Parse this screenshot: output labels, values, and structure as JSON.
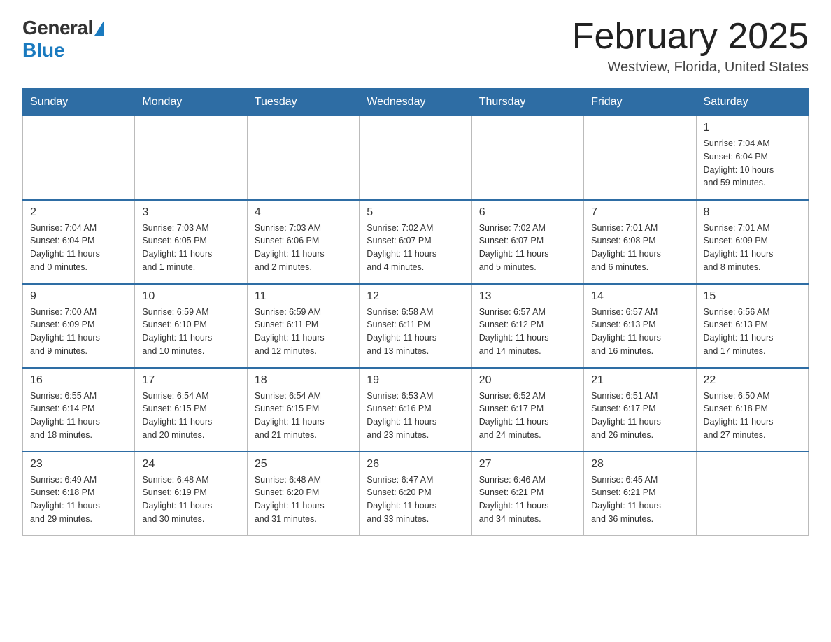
{
  "header": {
    "logo_general": "General",
    "logo_blue": "Blue",
    "title": "February 2025",
    "location": "Westview, Florida, United States"
  },
  "days_of_week": [
    "Sunday",
    "Monday",
    "Tuesday",
    "Wednesday",
    "Thursday",
    "Friday",
    "Saturday"
  ],
  "weeks": [
    [
      {
        "day": "",
        "info": ""
      },
      {
        "day": "",
        "info": ""
      },
      {
        "day": "",
        "info": ""
      },
      {
        "day": "",
        "info": ""
      },
      {
        "day": "",
        "info": ""
      },
      {
        "day": "",
        "info": ""
      },
      {
        "day": "1",
        "info": "Sunrise: 7:04 AM\nSunset: 6:04 PM\nDaylight: 10 hours\nand 59 minutes."
      }
    ],
    [
      {
        "day": "2",
        "info": "Sunrise: 7:04 AM\nSunset: 6:04 PM\nDaylight: 11 hours\nand 0 minutes."
      },
      {
        "day": "3",
        "info": "Sunrise: 7:03 AM\nSunset: 6:05 PM\nDaylight: 11 hours\nand 1 minute."
      },
      {
        "day": "4",
        "info": "Sunrise: 7:03 AM\nSunset: 6:06 PM\nDaylight: 11 hours\nand 2 minutes."
      },
      {
        "day": "5",
        "info": "Sunrise: 7:02 AM\nSunset: 6:07 PM\nDaylight: 11 hours\nand 4 minutes."
      },
      {
        "day": "6",
        "info": "Sunrise: 7:02 AM\nSunset: 6:07 PM\nDaylight: 11 hours\nand 5 minutes."
      },
      {
        "day": "7",
        "info": "Sunrise: 7:01 AM\nSunset: 6:08 PM\nDaylight: 11 hours\nand 6 minutes."
      },
      {
        "day": "8",
        "info": "Sunrise: 7:01 AM\nSunset: 6:09 PM\nDaylight: 11 hours\nand 8 minutes."
      }
    ],
    [
      {
        "day": "9",
        "info": "Sunrise: 7:00 AM\nSunset: 6:09 PM\nDaylight: 11 hours\nand 9 minutes."
      },
      {
        "day": "10",
        "info": "Sunrise: 6:59 AM\nSunset: 6:10 PM\nDaylight: 11 hours\nand 10 minutes."
      },
      {
        "day": "11",
        "info": "Sunrise: 6:59 AM\nSunset: 6:11 PM\nDaylight: 11 hours\nand 12 minutes."
      },
      {
        "day": "12",
        "info": "Sunrise: 6:58 AM\nSunset: 6:11 PM\nDaylight: 11 hours\nand 13 minutes."
      },
      {
        "day": "13",
        "info": "Sunrise: 6:57 AM\nSunset: 6:12 PM\nDaylight: 11 hours\nand 14 minutes."
      },
      {
        "day": "14",
        "info": "Sunrise: 6:57 AM\nSunset: 6:13 PM\nDaylight: 11 hours\nand 16 minutes."
      },
      {
        "day": "15",
        "info": "Sunrise: 6:56 AM\nSunset: 6:13 PM\nDaylight: 11 hours\nand 17 minutes."
      }
    ],
    [
      {
        "day": "16",
        "info": "Sunrise: 6:55 AM\nSunset: 6:14 PM\nDaylight: 11 hours\nand 18 minutes."
      },
      {
        "day": "17",
        "info": "Sunrise: 6:54 AM\nSunset: 6:15 PM\nDaylight: 11 hours\nand 20 minutes."
      },
      {
        "day": "18",
        "info": "Sunrise: 6:54 AM\nSunset: 6:15 PM\nDaylight: 11 hours\nand 21 minutes."
      },
      {
        "day": "19",
        "info": "Sunrise: 6:53 AM\nSunset: 6:16 PM\nDaylight: 11 hours\nand 23 minutes."
      },
      {
        "day": "20",
        "info": "Sunrise: 6:52 AM\nSunset: 6:17 PM\nDaylight: 11 hours\nand 24 minutes."
      },
      {
        "day": "21",
        "info": "Sunrise: 6:51 AM\nSunset: 6:17 PM\nDaylight: 11 hours\nand 26 minutes."
      },
      {
        "day": "22",
        "info": "Sunrise: 6:50 AM\nSunset: 6:18 PM\nDaylight: 11 hours\nand 27 minutes."
      }
    ],
    [
      {
        "day": "23",
        "info": "Sunrise: 6:49 AM\nSunset: 6:18 PM\nDaylight: 11 hours\nand 29 minutes."
      },
      {
        "day": "24",
        "info": "Sunrise: 6:48 AM\nSunset: 6:19 PM\nDaylight: 11 hours\nand 30 minutes."
      },
      {
        "day": "25",
        "info": "Sunrise: 6:48 AM\nSunset: 6:20 PM\nDaylight: 11 hours\nand 31 minutes."
      },
      {
        "day": "26",
        "info": "Sunrise: 6:47 AM\nSunset: 6:20 PM\nDaylight: 11 hours\nand 33 minutes."
      },
      {
        "day": "27",
        "info": "Sunrise: 6:46 AM\nSunset: 6:21 PM\nDaylight: 11 hours\nand 34 minutes."
      },
      {
        "day": "28",
        "info": "Sunrise: 6:45 AM\nSunset: 6:21 PM\nDaylight: 11 hours\nand 36 minutes."
      },
      {
        "day": "",
        "info": ""
      }
    ]
  ]
}
